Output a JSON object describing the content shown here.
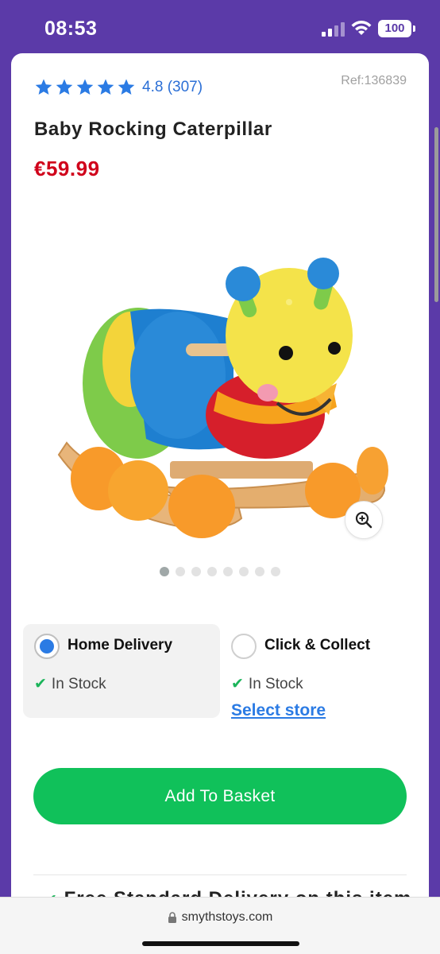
{
  "status": {
    "time": "08:53",
    "battery": "100"
  },
  "product": {
    "rating_value": "4.8",
    "review_count": "(307)",
    "stars": 5,
    "ref": "Ref:136839",
    "title": "Baby Rocking Caterpillar",
    "price": "€59.99",
    "image_count": 8,
    "active_image": 1
  },
  "delivery": {
    "home": {
      "label": "Home Delivery",
      "stock": "In Stock",
      "selected": true
    },
    "collect": {
      "label": "Click & Collect",
      "stock": "In Stock",
      "select_store": "Select store",
      "selected": false
    }
  },
  "cta": {
    "add_to_basket": "Add To Basket"
  },
  "footer_partial": "Free Standard Delivery on this item",
  "browser": {
    "url": "smythstoys.com"
  },
  "colors": {
    "header": "#5b3aa8",
    "price": "#d0021b",
    "cta": "#10c15a",
    "link": "#2b7be4",
    "star": "#2b7be4"
  }
}
